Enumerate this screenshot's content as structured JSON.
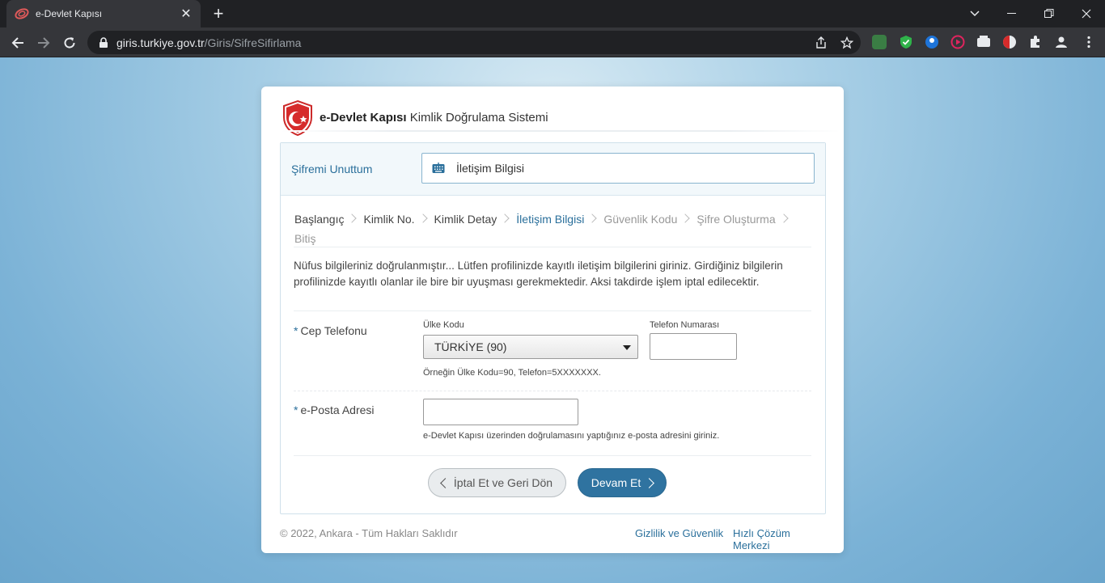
{
  "browser": {
    "tab_title": "e-Devlet Kapısı",
    "tab_close": "✕",
    "new_tab": "+",
    "url_host": "giris.turkiye.gov.tr",
    "url_path": "/Giris/SifreSifirlama"
  },
  "header": {
    "brand_bold": "e-Devlet Kapısı",
    "brand_rest": " Kimlik Doğrulama Sistemi"
  },
  "panel": {
    "title": "Şifremi Unuttum",
    "current_step": "İletişim Bilgisi"
  },
  "steps": [
    {
      "label": "Başlangıç",
      "state": "done"
    },
    {
      "label": "Kimlik No.",
      "state": "done"
    },
    {
      "label": "Kimlik Detay",
      "state": "done"
    },
    {
      "label": "İletişim Bilgisi",
      "state": "active"
    },
    {
      "label": "Güvenlik Kodu",
      "state": "future"
    },
    {
      "label": "Şifre Oluşturma",
      "state": "future"
    },
    {
      "label": "Bitiş",
      "state": "future"
    }
  ],
  "info_text": "Nüfus bilgileriniz doğrulanmıştır... Lütfen profilinizde kayıtlı iletişim bilgilerini giriniz. Girdiğiniz bilgilerin profilinizde kayıtlı olanlar ile bire bir uyuşması gerekmektedir. Aksi takdirde işlem iptal edilecektir.",
  "phone": {
    "required_mark": "*",
    "label": "Cep Telefonu",
    "country_label": "Ülke Kodu",
    "country_value": "TÜRKİYE (90)",
    "number_label": "Telefon Numarası",
    "number_value": "",
    "hint": "Örneğin Ülke Kodu=90, Telefon=5XXXXXXX."
  },
  "email": {
    "required_mark": "*",
    "label": "e-Posta Adresi",
    "value": "",
    "hint": "e-Devlet Kapısı üzerinden doğrulamasını yaptığınız e-posta adresini giriniz."
  },
  "buttons": {
    "cancel": "İptal Et ve Geri Dön",
    "next": "Devam Et"
  },
  "footer": {
    "copyright": "© 2022, Ankara - Tüm Hakları Saklıdır",
    "privacy": "Gizlilik ve Güvenlik",
    "help": "Hızlı Çözüm Merkezi"
  },
  "colors": {
    "accent": "#2a6f9b",
    "button_primary": "#2f73a0",
    "logo_red": "#d62b2b"
  },
  "icons": [
    "edevlet-favicon",
    "back-arrow-icon",
    "forward-arrow-icon",
    "reload-icon",
    "lock-icon",
    "share-icon",
    "star-icon",
    "keyboard-icon",
    "puzzle-icon",
    "profile-icon",
    "menu-dots-icon"
  ]
}
